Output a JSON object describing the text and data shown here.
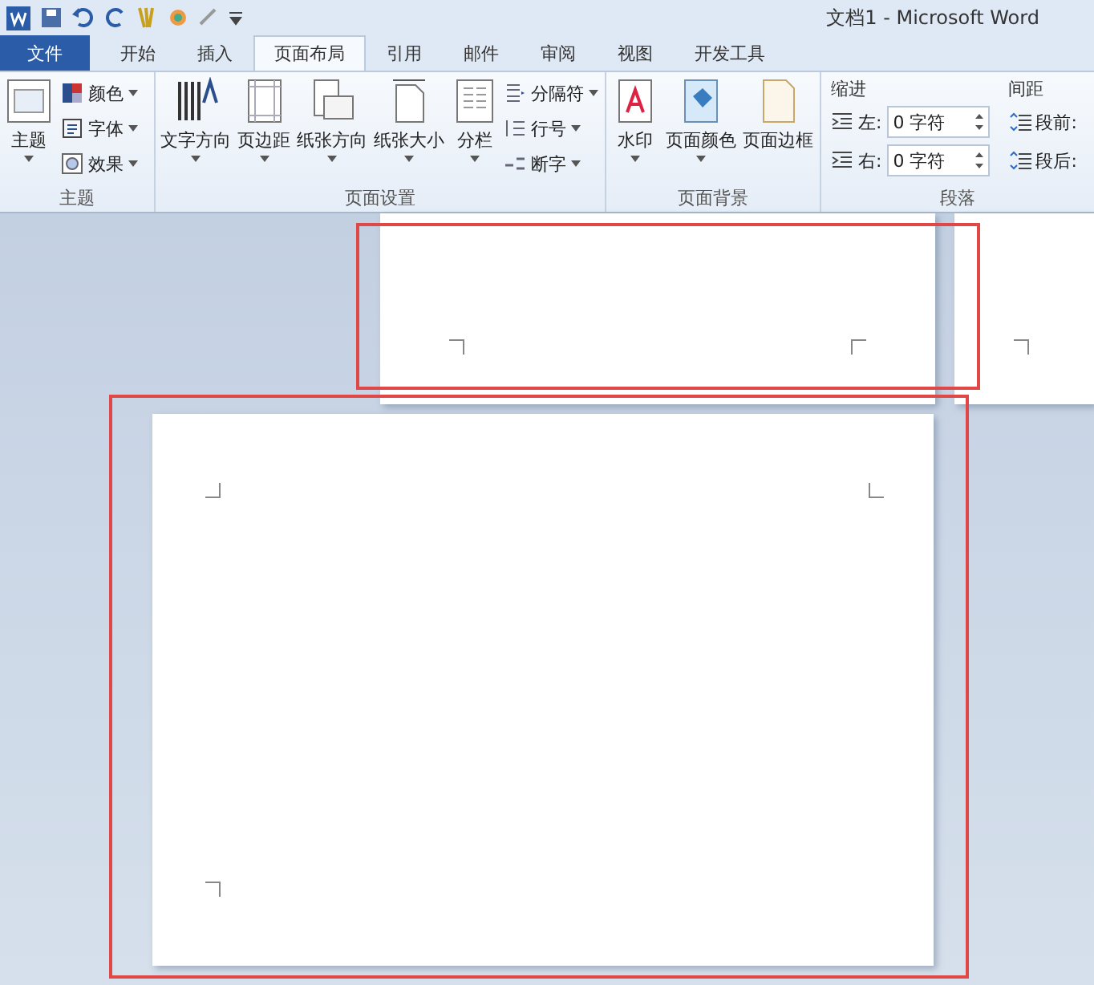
{
  "window": {
    "title": "文档1 - Microsoft Word"
  },
  "tabs": [
    {
      "label": "文件",
      "kind": "file",
      "selected": false
    },
    {
      "label": "开始",
      "kind": "tab",
      "selected": false
    },
    {
      "label": "插入",
      "kind": "tab",
      "selected": false
    },
    {
      "label": "页面布局",
      "kind": "tab",
      "selected": true
    },
    {
      "label": "引用",
      "kind": "tab",
      "selected": false
    },
    {
      "label": "邮件",
      "kind": "tab",
      "selected": false
    },
    {
      "label": "审阅",
      "kind": "tab",
      "selected": false
    },
    {
      "label": "视图",
      "kind": "tab",
      "selected": false
    },
    {
      "label": "开发工具",
      "kind": "tab",
      "selected": false
    }
  ],
  "ribbon": {
    "themes": {
      "label": "主题",
      "big": [
        {
          "label": "主题",
          "dropdown": true
        }
      ],
      "small": [
        {
          "label": "颜色",
          "dropdown": true
        },
        {
          "label": "字体",
          "dropdown": true
        },
        {
          "label": "效果",
          "dropdown": true
        }
      ]
    },
    "page_setup": {
      "label": "页面设置",
      "big": [
        {
          "label": "文字方向",
          "dropdown": true
        },
        {
          "label": "页边距",
          "dropdown": true
        },
        {
          "label": "纸张方向",
          "dropdown": true
        },
        {
          "label": "纸张大小",
          "dropdown": true
        },
        {
          "label": "分栏",
          "dropdown": true
        }
      ],
      "small": [
        {
          "label": "分隔符",
          "dropdown": true
        },
        {
          "label": "行号",
          "dropdown": true
        },
        {
          "label": "断字",
          "dropdown": true
        }
      ]
    },
    "page_background": {
      "label": "页面背景",
      "big": [
        {
          "label": "水印",
          "dropdown": true
        },
        {
          "label": "页面颜色",
          "dropdown": true
        },
        {
          "label": "页面边框",
          "dropdown": false
        }
      ]
    },
    "paragraph": {
      "label": "段落",
      "indent": {
        "heading": "缩进",
        "fields": [
          {
            "label": "左:",
            "value": "0 字符"
          },
          {
            "label": "右:",
            "value": "0 字符"
          }
        ]
      },
      "spacing": {
        "heading": "间距",
        "fields": [
          {
            "label": "段前:"
          },
          {
            "label": "段后:"
          }
        ]
      }
    }
  }
}
